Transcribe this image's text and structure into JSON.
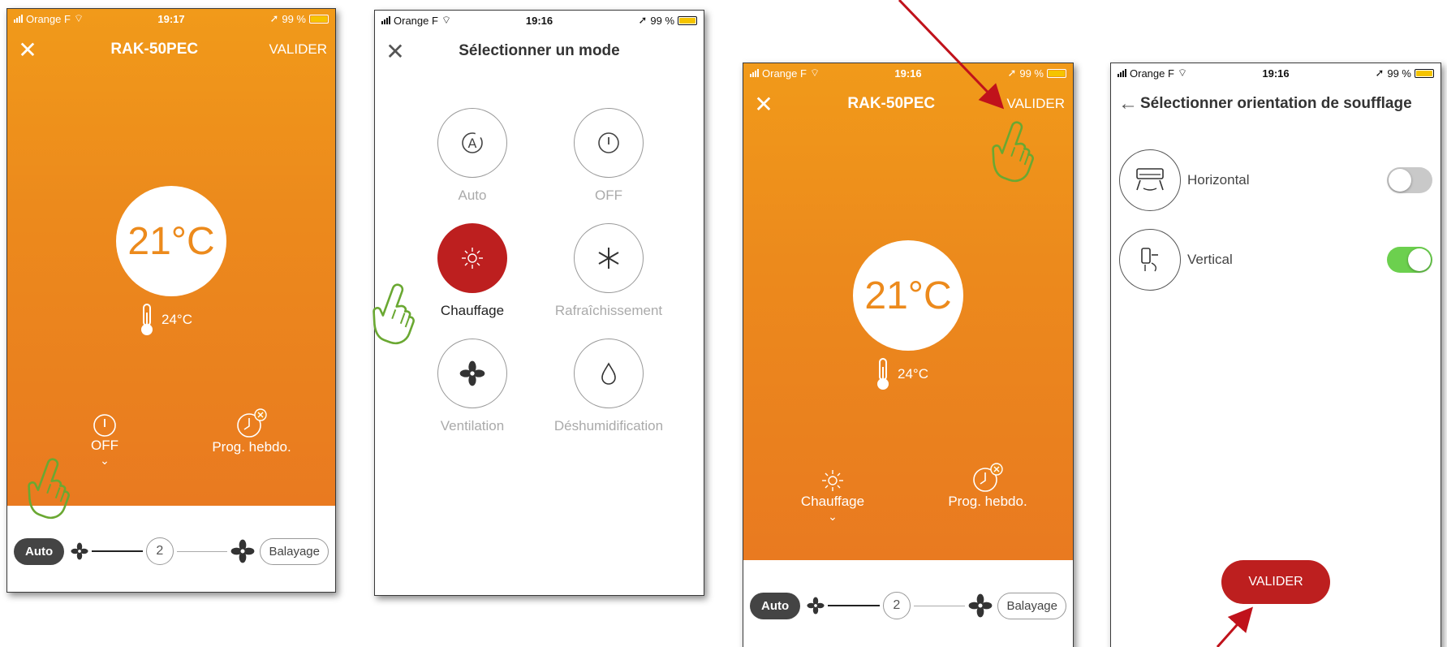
{
  "status_bars": [
    {
      "carrier": "Orange F",
      "time": "19:17",
      "battery": "99 %"
    },
    {
      "carrier": "Orange F",
      "time": "19:16",
      "battery": "99 %"
    },
    {
      "carrier": "Orange F",
      "time": "19:16",
      "battery": "99 %"
    },
    {
      "carrier": "Orange F",
      "time": "19:16",
      "battery": "99 %"
    }
  ],
  "screen1": {
    "title": "RAK-50PEC",
    "action": "VALIDER",
    "setpoint": "21°C",
    "ambient": "24°C",
    "mode_label": "OFF",
    "prog_label": "Prog. hebdo.",
    "fan": {
      "auto": "Auto",
      "level": "2",
      "balayage": "Balayage"
    }
  },
  "screen2": {
    "title": "Sélectionner un mode",
    "modes": [
      {
        "label": "Auto",
        "icon": "auto-mode-icon"
      },
      {
        "label": "OFF",
        "icon": "power-icon"
      },
      {
        "label": "Chauffage",
        "icon": "sun-icon",
        "active": true
      },
      {
        "label": "Rafraîchissement",
        "icon": "snowflake-icon"
      },
      {
        "label": "Ventilation",
        "icon": "fan-icon"
      },
      {
        "label": "Déshumidification",
        "icon": "droplet-icon"
      }
    ]
  },
  "screen3": {
    "title": "RAK-50PEC",
    "action": "VALIDER",
    "setpoint": "21°C",
    "ambient": "24°C",
    "mode_label": "Chauffage",
    "prog_label": "Prog. hebdo.",
    "fan": {
      "auto": "Auto",
      "level": "2",
      "balayage": "Balayage"
    }
  },
  "screen4": {
    "title": "Sélectionner orientation de soufflage",
    "options": [
      {
        "label": "Horizontal",
        "enabled": false
      },
      {
        "label": "Vertical",
        "enabled": true
      }
    ],
    "button": "VALIDER"
  },
  "colors": {
    "orange": "#ec8a1c",
    "red": "#bd1f1f",
    "green_toggle": "#6cd04e",
    "hand_green": "#6aa832",
    "arrow_red": "#c0121b"
  }
}
